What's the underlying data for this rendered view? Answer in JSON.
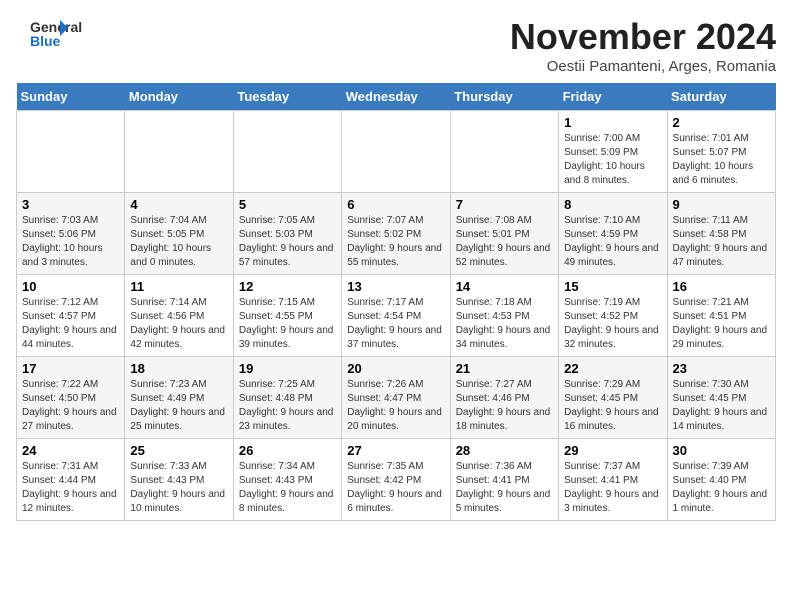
{
  "header": {
    "logo_line1": "General",
    "logo_line2": "Blue",
    "month": "November 2024",
    "location": "Oestii Pamanteni, Arges, Romania"
  },
  "weekdays": [
    "Sunday",
    "Monday",
    "Tuesday",
    "Wednesday",
    "Thursday",
    "Friday",
    "Saturday"
  ],
  "weeks": [
    [
      {
        "day": "",
        "info": ""
      },
      {
        "day": "",
        "info": ""
      },
      {
        "day": "",
        "info": ""
      },
      {
        "day": "",
        "info": ""
      },
      {
        "day": "",
        "info": ""
      },
      {
        "day": "1",
        "info": "Sunrise: 7:00 AM\nSunset: 5:09 PM\nDaylight: 10 hours and 8 minutes."
      },
      {
        "day": "2",
        "info": "Sunrise: 7:01 AM\nSunset: 5:07 PM\nDaylight: 10 hours and 6 minutes."
      }
    ],
    [
      {
        "day": "3",
        "info": "Sunrise: 7:03 AM\nSunset: 5:06 PM\nDaylight: 10 hours and 3 minutes."
      },
      {
        "day": "4",
        "info": "Sunrise: 7:04 AM\nSunset: 5:05 PM\nDaylight: 10 hours and 0 minutes."
      },
      {
        "day": "5",
        "info": "Sunrise: 7:05 AM\nSunset: 5:03 PM\nDaylight: 9 hours and 57 minutes."
      },
      {
        "day": "6",
        "info": "Sunrise: 7:07 AM\nSunset: 5:02 PM\nDaylight: 9 hours and 55 minutes."
      },
      {
        "day": "7",
        "info": "Sunrise: 7:08 AM\nSunset: 5:01 PM\nDaylight: 9 hours and 52 minutes."
      },
      {
        "day": "8",
        "info": "Sunrise: 7:10 AM\nSunset: 4:59 PM\nDaylight: 9 hours and 49 minutes."
      },
      {
        "day": "9",
        "info": "Sunrise: 7:11 AM\nSunset: 4:58 PM\nDaylight: 9 hours and 47 minutes."
      }
    ],
    [
      {
        "day": "10",
        "info": "Sunrise: 7:12 AM\nSunset: 4:57 PM\nDaylight: 9 hours and 44 minutes."
      },
      {
        "day": "11",
        "info": "Sunrise: 7:14 AM\nSunset: 4:56 PM\nDaylight: 9 hours and 42 minutes."
      },
      {
        "day": "12",
        "info": "Sunrise: 7:15 AM\nSunset: 4:55 PM\nDaylight: 9 hours and 39 minutes."
      },
      {
        "day": "13",
        "info": "Sunrise: 7:17 AM\nSunset: 4:54 PM\nDaylight: 9 hours and 37 minutes."
      },
      {
        "day": "14",
        "info": "Sunrise: 7:18 AM\nSunset: 4:53 PM\nDaylight: 9 hours and 34 minutes."
      },
      {
        "day": "15",
        "info": "Sunrise: 7:19 AM\nSunset: 4:52 PM\nDaylight: 9 hours and 32 minutes."
      },
      {
        "day": "16",
        "info": "Sunrise: 7:21 AM\nSunset: 4:51 PM\nDaylight: 9 hours and 29 minutes."
      }
    ],
    [
      {
        "day": "17",
        "info": "Sunrise: 7:22 AM\nSunset: 4:50 PM\nDaylight: 9 hours and 27 minutes."
      },
      {
        "day": "18",
        "info": "Sunrise: 7:23 AM\nSunset: 4:49 PM\nDaylight: 9 hours and 25 minutes."
      },
      {
        "day": "19",
        "info": "Sunrise: 7:25 AM\nSunset: 4:48 PM\nDaylight: 9 hours and 23 minutes."
      },
      {
        "day": "20",
        "info": "Sunrise: 7:26 AM\nSunset: 4:47 PM\nDaylight: 9 hours and 20 minutes."
      },
      {
        "day": "21",
        "info": "Sunrise: 7:27 AM\nSunset: 4:46 PM\nDaylight: 9 hours and 18 minutes."
      },
      {
        "day": "22",
        "info": "Sunrise: 7:29 AM\nSunset: 4:45 PM\nDaylight: 9 hours and 16 minutes."
      },
      {
        "day": "23",
        "info": "Sunrise: 7:30 AM\nSunset: 4:45 PM\nDaylight: 9 hours and 14 minutes."
      }
    ],
    [
      {
        "day": "24",
        "info": "Sunrise: 7:31 AM\nSunset: 4:44 PM\nDaylight: 9 hours and 12 minutes."
      },
      {
        "day": "25",
        "info": "Sunrise: 7:33 AM\nSunset: 4:43 PM\nDaylight: 9 hours and 10 minutes."
      },
      {
        "day": "26",
        "info": "Sunrise: 7:34 AM\nSunset: 4:43 PM\nDaylight: 9 hours and 8 minutes."
      },
      {
        "day": "27",
        "info": "Sunrise: 7:35 AM\nSunset: 4:42 PM\nDaylight: 9 hours and 6 minutes."
      },
      {
        "day": "28",
        "info": "Sunrise: 7:36 AM\nSunset: 4:41 PM\nDaylight: 9 hours and 5 minutes."
      },
      {
        "day": "29",
        "info": "Sunrise: 7:37 AM\nSunset: 4:41 PM\nDaylight: 9 hours and 3 minutes."
      },
      {
        "day": "30",
        "info": "Sunrise: 7:39 AM\nSunset: 4:40 PM\nDaylight: 9 hours and 1 minute."
      }
    ]
  ]
}
